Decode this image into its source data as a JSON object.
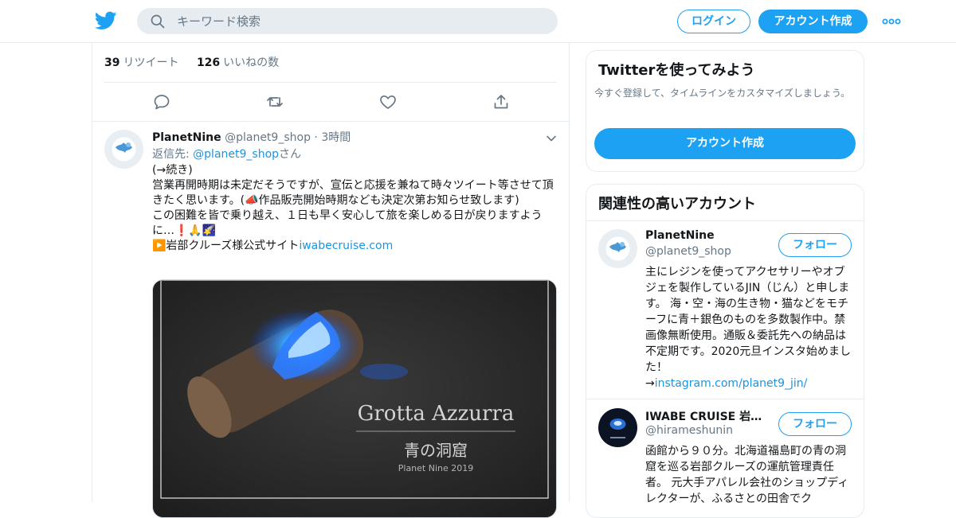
{
  "header": {
    "search_placeholder": "キーワード検索",
    "login_label": "ログイン",
    "signup_label": "アカウント作成"
  },
  "stats": {
    "retweet_count": "39",
    "retweet_label": "リツイート",
    "like_count": "126",
    "like_label": "いいねの数"
  },
  "tweet": {
    "name": "PlanetNine",
    "handle": "@planet9_shop",
    "time": "3時間",
    "reply_prefix": "返信先: ",
    "reply_handle": "@planet9_shop",
    "reply_suffix": "さん",
    "line1": "(→続き)",
    "line2": "営業再開時期は未定だそうですが、宣伝と応援を兼ねて時々ツイート等させて頂きたく思います。(📣作品販売開始時期なども決定次第お知らせ致します)",
    "line3": "この困難を皆で乗り越え、１日も早く安心して旅を楽しめる日が戻りますように…❗🙏🌠",
    "line4_prefix": "▶️岩部クルーズ様公式サイト",
    "line4_link": "iwabecruise.com",
    "media_title": "Grotta Azzurra",
    "media_subtitle": "青の洞窟",
    "media_caption": "Planet Nine 2019"
  },
  "sidebar": {
    "try_title": "Twitterを使ってみよう",
    "try_desc": "今すぐ登録して、タイムラインをカスタマイズしましょう。",
    "try_button": "アカウント作成",
    "related_title": "関連性の高いアカウント",
    "accounts": [
      {
        "name": "PlanetNine",
        "handle": "@planet9_shop",
        "follow_label": "フォロー",
        "bio": "主にレジンを使ってアクセサリーやオブジェを製作しているJIN（じん）と申します。 海・空・海の生き物・猫などをモチーフに青＋銀色のものを多数製作中。禁画像無断使用。通販＆委託先への納品は不定期です。2020元旦インスタ始めました！",
        "bio_link_prefix": "→",
        "bio_link": "instagram.com/planet9_jin/"
      },
      {
        "name": "IWABE CRUISE 岩…",
        "handle": "@hirameshunin",
        "follow_label": "フォロー",
        "bio": "函館から９０分。北海道福島町の青の洞窟を巡る岩部クルーズの運航管理責任者。 元大手アパレル会社のショップディレクターが、ふるさとの田舎でク"
      }
    ]
  },
  "colors": {
    "accent": "#1da1f2",
    "link": "#1b95e0",
    "muted": "#657786",
    "border": "#e6ecf0"
  }
}
